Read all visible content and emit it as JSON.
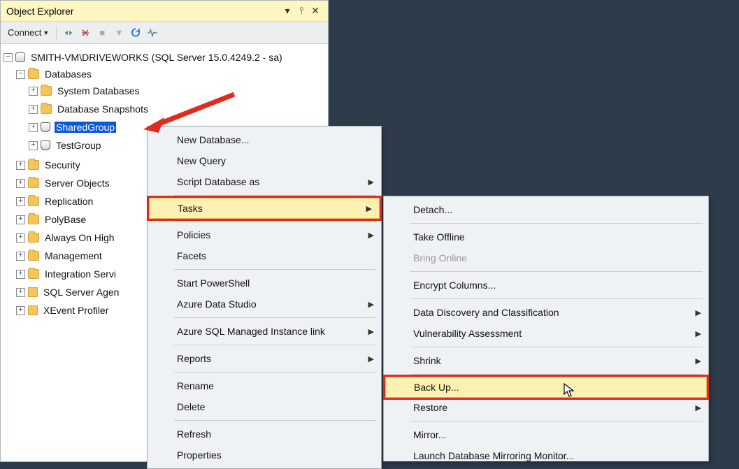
{
  "panel": {
    "title": "Object Explorer"
  },
  "toolbar": {
    "connect": "Connect"
  },
  "tree": {
    "server": "SMITH-VM\\DRIVEWORKS (SQL Server 15.0.4249.2 - sa)",
    "databases": "Databases",
    "sysdb": "System Databases",
    "dbsnap": "Database Snapshots",
    "sharedgroup": "SharedGroup",
    "testgroup": "TestGroup",
    "security": "Security",
    "serverobjects": "Server Objects",
    "replication": "Replication",
    "polybase": "PolyBase",
    "alwayson": "Always On High",
    "management": "Management",
    "integration": "Integration Servi",
    "agent": "SQL Server Agen",
    "xevent": "XEvent Profiler"
  },
  "menu1": {
    "newdb": "New Database...",
    "newquery": "New Query",
    "scriptdb": "Script Database as",
    "tasks": "Tasks",
    "policies": "Policies",
    "facets": "Facets",
    "startps": "Start PowerShell",
    "ads": "Azure Data Studio",
    "azlink": "Azure SQL Managed Instance link",
    "reports": "Reports",
    "rename": "Rename",
    "delete": "Delete",
    "refresh": "Refresh",
    "properties": "Properties"
  },
  "menu2": {
    "detach": "Detach...",
    "takeoffline": "Take Offline",
    "bringonline": "Bring Online",
    "encrypt": "Encrypt Columns...",
    "datadisc": "Data Discovery and Classification",
    "vuln": "Vulnerability Assessment",
    "shrink": "Shrink",
    "backup": "Back Up...",
    "restore": "Restore",
    "mirror": "Mirror...",
    "launchmirror": "Launch Database Mirroring Monitor..."
  }
}
